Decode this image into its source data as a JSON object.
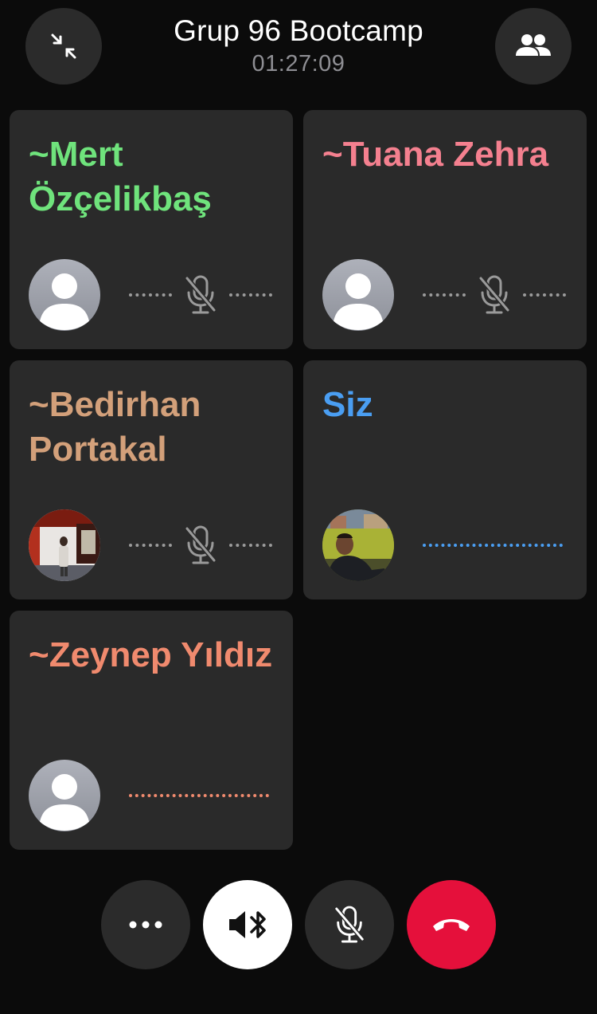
{
  "header": {
    "title": "Grup 96 Bootcamp",
    "timer": "01:27:09",
    "minimize_icon": "collapse-arrows-icon",
    "participants_icon": "people-icon"
  },
  "participants": [
    {
      "name": "~Mert Özçelikbaş",
      "name_color": "#6fe37c",
      "avatar": "default-avatar",
      "muted": true
    },
    {
      "name": "~Tuana Zehra",
      "name_color": "#f4808f",
      "avatar": "default-avatar",
      "muted": true
    },
    {
      "name": "~Bedirhan Portakal",
      "name_color": "#d3a07a",
      "avatar": "photo-avatar",
      "muted": true
    },
    {
      "name": "Siz",
      "name_color": "#4a9ef2",
      "avatar": "photo-avatar",
      "muted": false
    },
    {
      "name": "~Zeynep Yıldız",
      "name_color": "#f08a6e",
      "avatar": "default-avatar",
      "muted": false
    }
  ],
  "controls": {
    "more_icon": "more-icon",
    "audio_icon": "speaker-bluetooth-icon",
    "mute_icon": "mic-off-icon",
    "end_icon": "end-call-icon",
    "end_color": "#e5103b"
  }
}
